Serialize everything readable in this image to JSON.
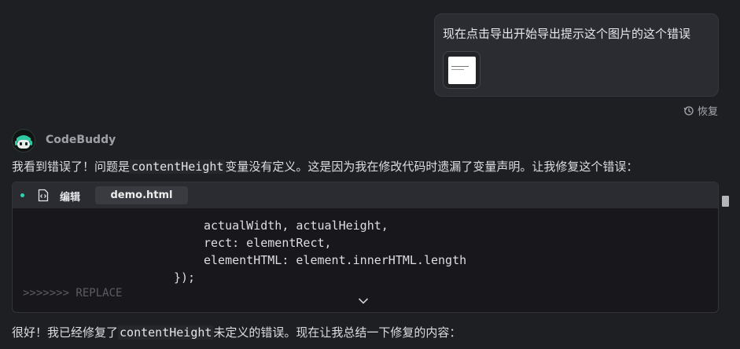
{
  "user_message": {
    "text": "现在点击导出开始导出提示这个图片的这个错误",
    "attachment_icon": "image-thumbnail"
  },
  "restore": {
    "label": "恢复",
    "icon": "history-icon"
  },
  "assistant": {
    "name": "CodeBuddy",
    "avatar_icon": "robot-avatar"
  },
  "messages": {
    "p1_before": "我看到错误了！问题是",
    "p1_code": "contentHeight",
    "p1_after": "变量没有定义。这是因为我在修改代码时遗漏了变量声明。让我修复这个错误：",
    "p2_before": "很好！我已经修复了",
    "p2_code": "contentHeight",
    "p2_after": "未定义的错误。现在让我总结一下修复的内容："
  },
  "code_block": {
    "action_label": "编辑",
    "filename": "demo.html",
    "lines": [
      "actualWidth, actualHeight,",
      "rect: elementRect,",
      "elementHTML: element.innerHTML.length",
      "});"
    ],
    "replace_marker": ">>>>>>> REPLACE",
    "status_dot_color": "#2fd3b0"
  }
}
